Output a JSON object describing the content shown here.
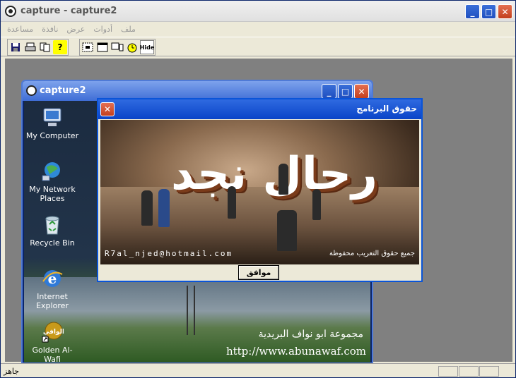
{
  "main": {
    "title": "capture - capture2",
    "menu": [
      "ملف",
      "أدوات",
      "عرض",
      "نافذة",
      "مساعدة"
    ],
    "toolbar": {
      "group1": [
        "save-icon",
        "print-icon",
        "copy-icon",
        "help-icon"
      ],
      "group2": [
        "region-capture-icon",
        "window-capture-icon",
        "fullscreen-capture-icon",
        "timer-icon",
        "hide-icon"
      ],
      "hide_label": "Hide"
    },
    "status": "جاهز"
  },
  "child": {
    "title": "capture2",
    "icons": [
      {
        "label": "My Computer",
        "icon": "my-computer-icon"
      },
      {
        "label": "My Network Places",
        "icon": "network-places-icon"
      },
      {
        "label": "Recycle Bin",
        "icon": "recycle-bin-icon"
      },
      {
        "label": "Internet Explorer",
        "icon": "internet-explorer-icon"
      },
      {
        "label": "Golden Al-Wafi Translator",
        "icon": "translator-icon"
      }
    ],
    "watermark_line1": "مجموعة ابو نواف البريدية",
    "watermark_line2": "http://www.abunawaf.com"
  },
  "dialog": {
    "title": "حقوق البرنامج",
    "banner_text": "رحال نجد",
    "email": "R7al_njed@hotmail.com",
    "rights": "جميع حقوق التعريب محفوظة",
    "ok_label": "موافق"
  }
}
